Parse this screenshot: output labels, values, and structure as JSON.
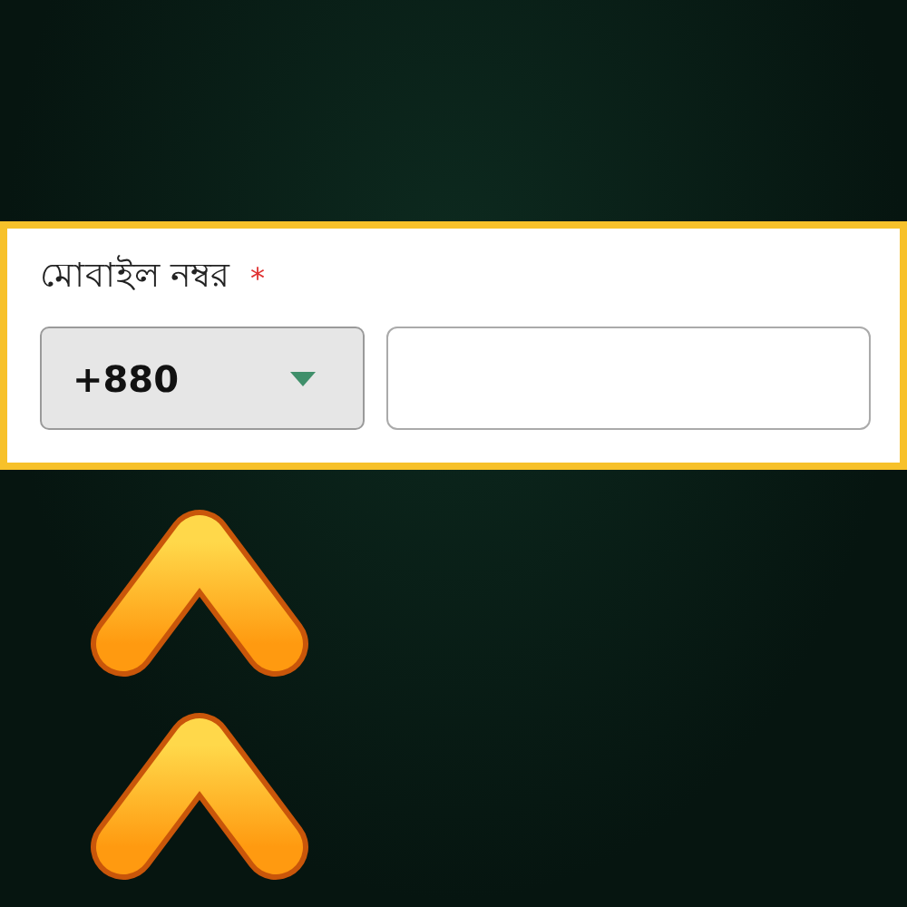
{
  "phone_form": {
    "label": "মোবাইল নম্বর",
    "required_mark": "*",
    "country_code": {
      "value": "+880"
    }
  }
}
